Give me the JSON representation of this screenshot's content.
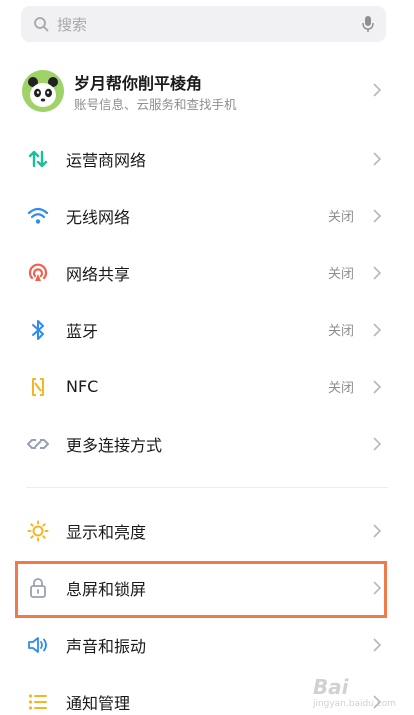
{
  "search": {
    "placeholder": "搜索",
    "icon": "search-icon",
    "mic_icon": "microphone-icon"
  },
  "account": {
    "name": "岁月帮你削平棱角",
    "subtitle": "账号信息、云服务和查找手机",
    "avatar_icon": "panda-avatar"
  },
  "connectivity": [
    {
      "label": "运营商网络",
      "value": "",
      "icon": "signal-arrows-icon",
      "color": "#1bbf9a"
    },
    {
      "label": "无线网络",
      "value": "关闭",
      "icon": "wifi-icon",
      "color": "#2d8cf0"
    },
    {
      "label": "网络共享",
      "value": "关闭",
      "icon": "hotspot-icon",
      "color": "#f0614f"
    },
    {
      "label": "蓝牙",
      "value": "关闭",
      "icon": "bluetooth-icon",
      "color": "#2d8cf0"
    },
    {
      "label": "NFC",
      "value": "关闭",
      "icon": "nfc-icon",
      "color": "#f5b623"
    },
    {
      "label": "更多连接方式",
      "value": "",
      "icon": "link-icon",
      "color": "#9aa0b4"
    }
  ],
  "display": [
    {
      "label": "显示和亮度",
      "value": "",
      "icon": "sun-icon",
      "color": "#f5b623"
    },
    {
      "label": "息屏和锁屏",
      "value": "",
      "icon": "lock-icon",
      "color": "#9aa0b4"
    },
    {
      "label": "声音和振动",
      "value": "",
      "icon": "speaker-icon",
      "color": "#2d8cf0"
    },
    {
      "label": "通知管理",
      "value": "",
      "icon": "list-icon",
      "color": "#f5b623"
    }
  ],
  "watermark": {
    "text": "Bai",
    "sub": "jingyan.baidu.com"
  }
}
